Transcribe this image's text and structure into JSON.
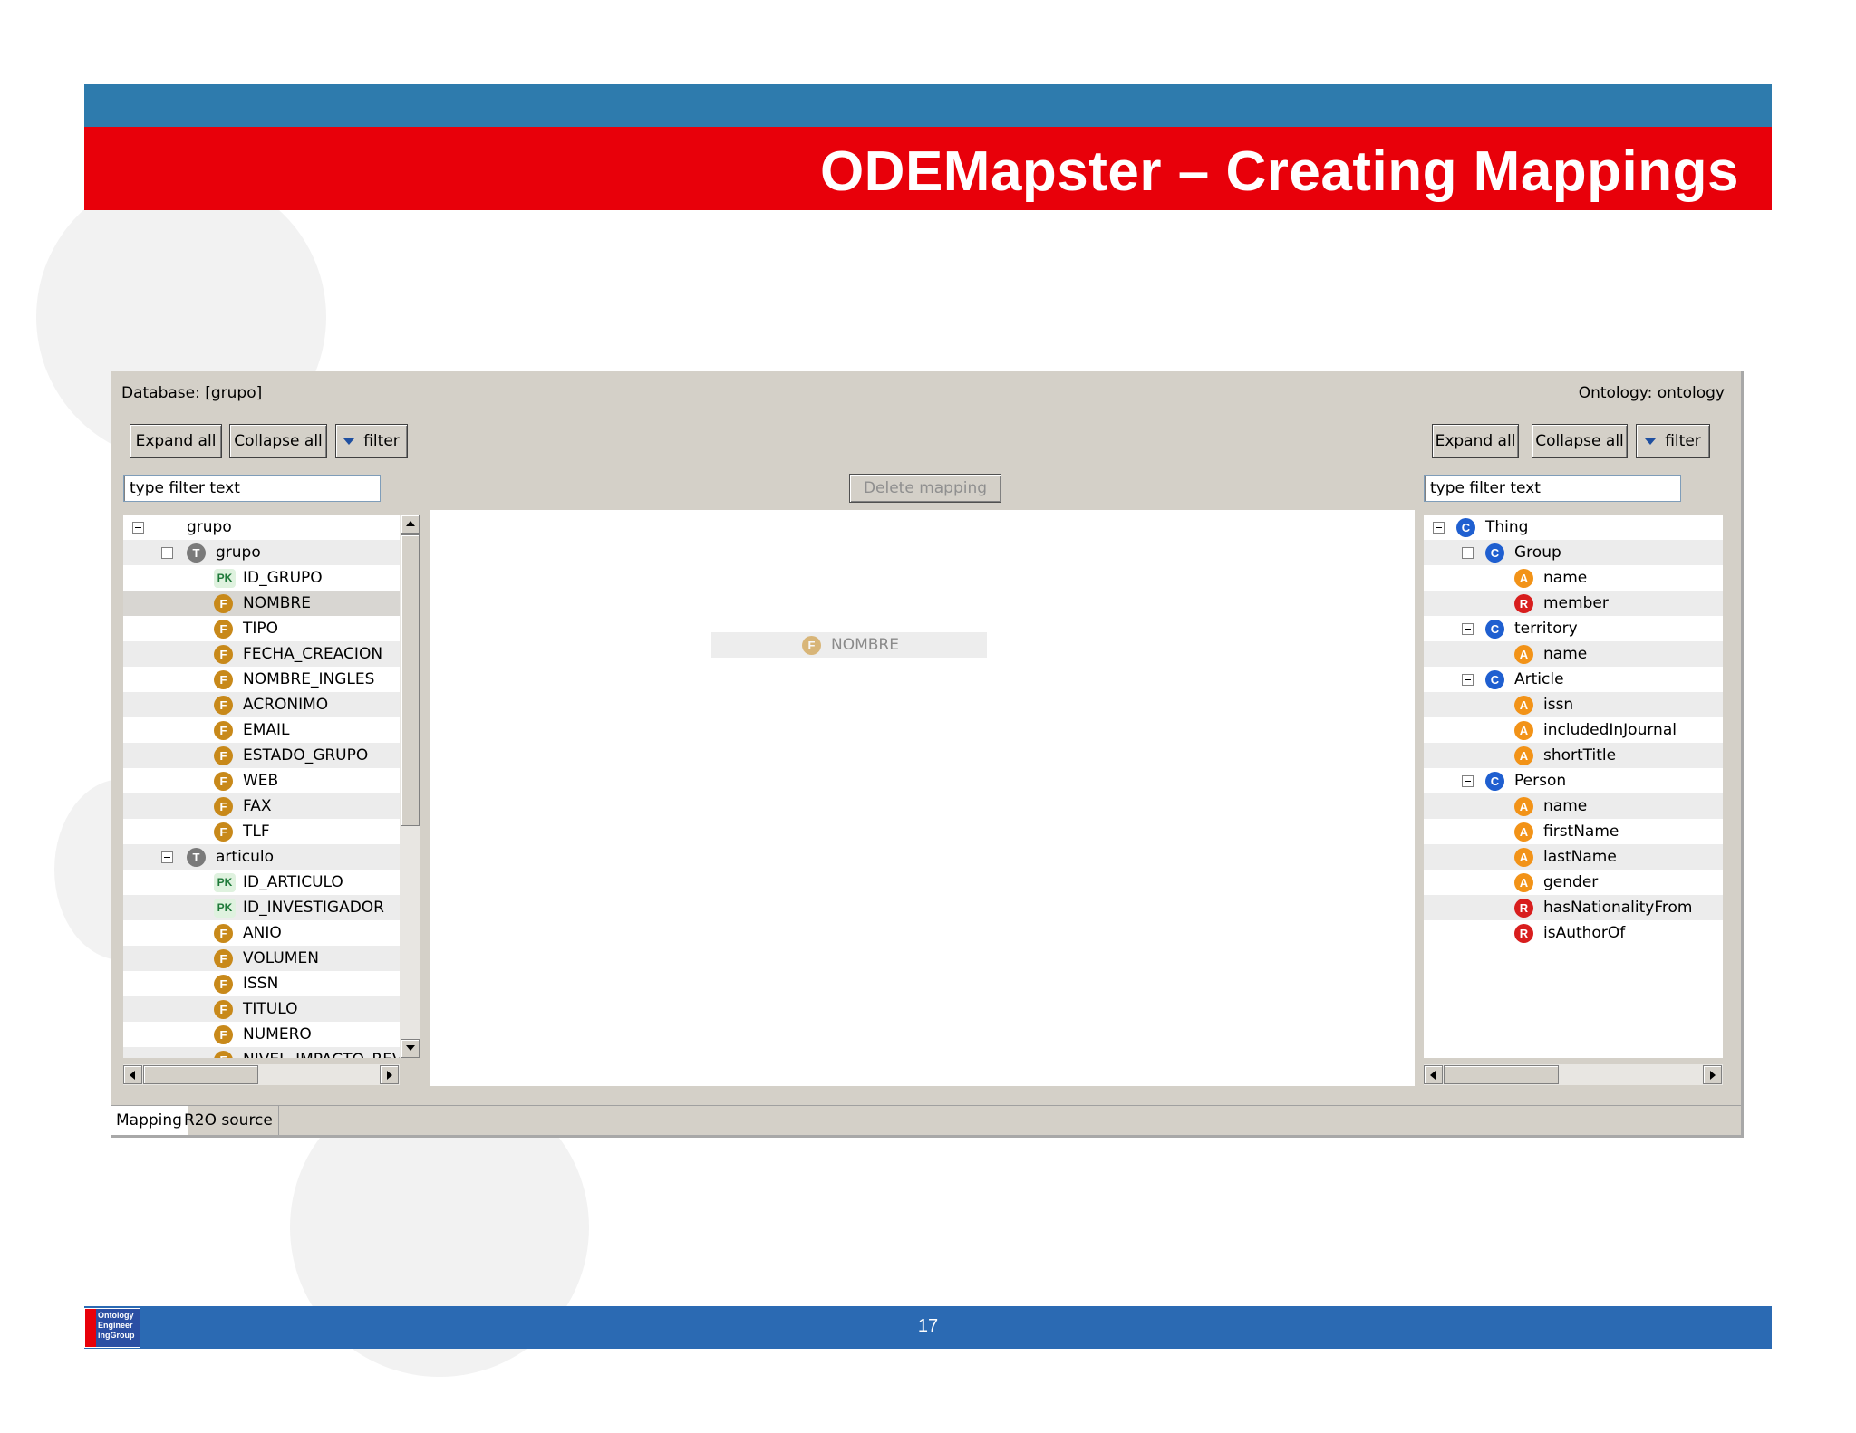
{
  "slide": {
    "title": "ODEMapster – Creating Mappings",
    "page_number": "17",
    "logo_text": [
      "Ontology",
      "Engineer",
      "ingGroup"
    ]
  },
  "app": {
    "database_label": "Database: [grupo]",
    "ontology_label": "Ontology: ontology",
    "left_toolbar": {
      "expand_all": "Expand all",
      "collapse_all": "Collapse all",
      "filter": "filter"
    },
    "right_toolbar": {
      "expand_all": "Expand all",
      "collapse_all": "Collapse all",
      "filter": "filter"
    },
    "left_filter_placeholder": "type filter text",
    "right_filter_placeholder": "type filter text",
    "delete_mapping": "Delete mapping",
    "canvas_node": {
      "icon": "F",
      "label": "NOMBRE"
    },
    "tabs": [
      "Mapping",
      "R2O source"
    ],
    "db_tree": [
      {
        "label": "grupo",
        "icon": "",
        "level": 0,
        "toggle": true
      },
      {
        "label": "grupo",
        "icon": "T",
        "level": 1,
        "toggle": true
      },
      {
        "label": "ID_GRUPO",
        "icon": "PK",
        "level": 2
      },
      {
        "label": "NOMBRE",
        "icon": "F",
        "level": 2,
        "selected": true
      },
      {
        "label": "TIPO",
        "icon": "F",
        "level": 2
      },
      {
        "label": "FECHA_CREACION",
        "icon": "F",
        "level": 2
      },
      {
        "label": "NOMBRE_INGLES",
        "icon": "F",
        "level": 2
      },
      {
        "label": "ACRONIMO",
        "icon": "F",
        "level": 2
      },
      {
        "label": "EMAIL",
        "icon": "F",
        "level": 2
      },
      {
        "label": "ESTADO_GRUPO",
        "icon": "F",
        "level": 2
      },
      {
        "label": "WEB",
        "icon": "F",
        "level": 2
      },
      {
        "label": "FAX",
        "icon": "F",
        "level": 2
      },
      {
        "label": "TLF",
        "icon": "F",
        "level": 2
      },
      {
        "label": "articulo",
        "icon": "T",
        "level": 1,
        "toggle": true
      },
      {
        "label": "ID_ARTICULO",
        "icon": "PK",
        "level": 2
      },
      {
        "label": "ID_INVESTIGADOR",
        "icon": "PK",
        "level": 2
      },
      {
        "label": "ANIO",
        "icon": "F",
        "level": 2
      },
      {
        "label": "VOLUMEN",
        "icon": "F",
        "level": 2
      },
      {
        "label": "ISSN",
        "icon": "F",
        "level": 2
      },
      {
        "label": "TITULO",
        "icon": "F",
        "level": 2
      },
      {
        "label": "NUMERO",
        "icon": "F",
        "level": 2
      },
      {
        "label": "NIVEL_IMPACTO_REV",
        "icon": "F",
        "level": 2
      }
    ],
    "onto_tree": [
      {
        "label": "Thing",
        "icon": "C",
        "level": 0,
        "toggle": true
      },
      {
        "label": "Group",
        "icon": "C",
        "level": 1,
        "toggle": true
      },
      {
        "label": "name",
        "icon": "A",
        "level": 2
      },
      {
        "label": "member",
        "icon": "R",
        "level": 2
      },
      {
        "label": "territory",
        "icon": "C",
        "level": 1,
        "toggle": true
      },
      {
        "label": "name",
        "icon": "A",
        "level": 2
      },
      {
        "label": "Article",
        "icon": "C",
        "level": 1,
        "toggle": true
      },
      {
        "label": "issn",
        "icon": "A",
        "level": 2
      },
      {
        "label": "includedInJournal",
        "icon": "A",
        "level": 2
      },
      {
        "label": "shortTitle",
        "icon": "A",
        "level": 2
      },
      {
        "label": "Person",
        "icon": "C",
        "level": 1,
        "toggle": true
      },
      {
        "label": "name",
        "icon": "A",
        "level": 2
      },
      {
        "label": "firstName",
        "icon": "A",
        "level": 2
      },
      {
        "label": "lastName",
        "icon": "A",
        "level": 2
      },
      {
        "label": "gender",
        "icon": "A",
        "level": 2
      },
      {
        "label": "hasNationalityFrom",
        "icon": "R",
        "level": 2
      },
      {
        "label": "isAuthorOf",
        "icon": "R",
        "level": 2
      }
    ]
  },
  "colors": {
    "header_blue": "#2e7bad",
    "header_red": "#e8000a",
    "footer_blue": "#2b6ab3",
    "class_icon": "#1f5fd0",
    "attribute_icon": "#f29318",
    "relation_icon": "#d81e1e",
    "field_icon": "#c8891a"
  }
}
